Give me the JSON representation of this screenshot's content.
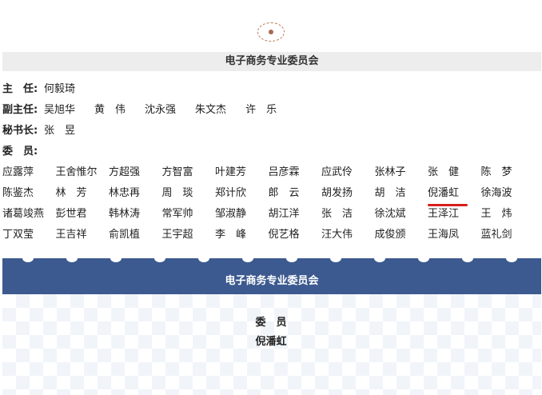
{
  "header": {
    "title": "电子商务专业委员会"
  },
  "roles": [
    {
      "label": "主　任:",
      "names": [
        "何毅琦"
      ]
    },
    {
      "label": "副主任:",
      "names": [
        "吴旭华",
        "黄　伟",
        "沈永强",
        "朱文杰",
        "许　乐"
      ]
    },
    {
      "label": "秘书长:",
      "names": [
        "张　昱"
      ]
    },
    {
      "label": "委　员:",
      "names": []
    }
  ],
  "members": [
    [
      "应露萍",
      "王舍惟尔",
      "方超强",
      "方智富",
      "叶建芳",
      "吕彦霖",
      "应武伶",
      "张林子",
      "张　健",
      "陈　梦"
    ],
    [
      "陈鉴杰",
      "林　芳",
      "林忠再",
      "周　琰",
      "郑计欣",
      "郎　云",
      "胡发扬",
      "胡　洁",
      "倪潘虹",
      "徐海波"
    ],
    [
      "诸葛竣燕",
      "彭世君",
      "韩林涛",
      "常军帅",
      "邹淑静",
      "胡江洋",
      "张　洁",
      "徐沈斌",
      "王泽江",
      "王　炜"
    ],
    [
      "丁双莹",
      "王吉祥",
      "俞凯植",
      "王宇超",
      "李　峰",
      "倪艺格",
      "汪大伟",
      "成俊颁",
      "王海凤",
      "蓝礼剑"
    ]
  ],
  "highlight": {
    "row": 1,
    "col": 8,
    "color": "#d81e1e"
  },
  "banner": {
    "title": "电子商务专业委员会",
    "color": "#3c5a8f"
  },
  "detail": {
    "role": "委　员",
    "name": "倪潘虹"
  }
}
